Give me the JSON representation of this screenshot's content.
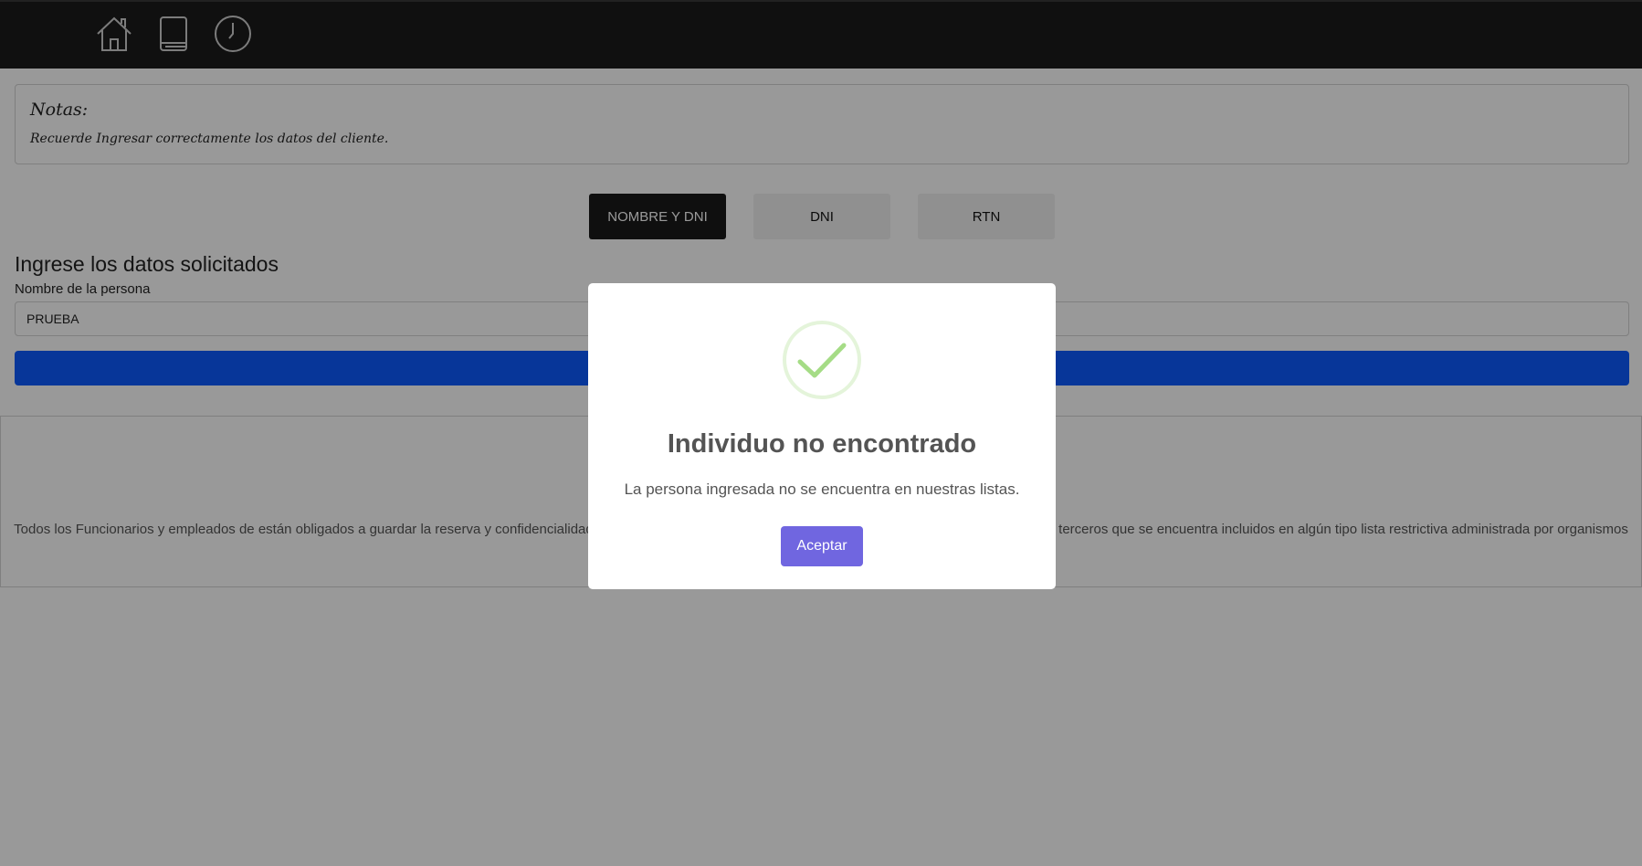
{
  "nav": {
    "icons": [
      "home-icon",
      "book-icon",
      "clock-icon"
    ]
  },
  "notes": {
    "title": "Notas:",
    "text": "Recuerde Ingresar correctamente los datos del cliente."
  },
  "tabs": [
    {
      "label": "NOMBRE Y DNI",
      "active": true
    },
    {
      "label": "DNI",
      "active": false
    },
    {
      "label": "RTN",
      "active": false
    }
  ],
  "form": {
    "title": "Ingrese los datos solicitados",
    "name_label": "Nombre de la persona",
    "name_value": "PRUEBA",
    "submit_color": "#0d5aff"
  },
  "disclaimer": {
    "text": "Todos los Funcionarios y empleados de están obligados a guardar la reserva y confidencialidad de la información sobre el conocimiento a clientes, usuarios, proveedores o terceros que se encuentra incluidos en algún tipo lista restrictiva administrada por organismos nacionales e internacionales o por las autoridades nacionales competentes."
  },
  "modal": {
    "icon": "check-circle-icon",
    "title": "Individuo no encontrado",
    "text": "La persona ingresada no se encuentra en nuestras listas.",
    "confirm_label": "Aceptar",
    "confirm_color": "#7066e0",
    "icon_color": "#a5dc86"
  }
}
